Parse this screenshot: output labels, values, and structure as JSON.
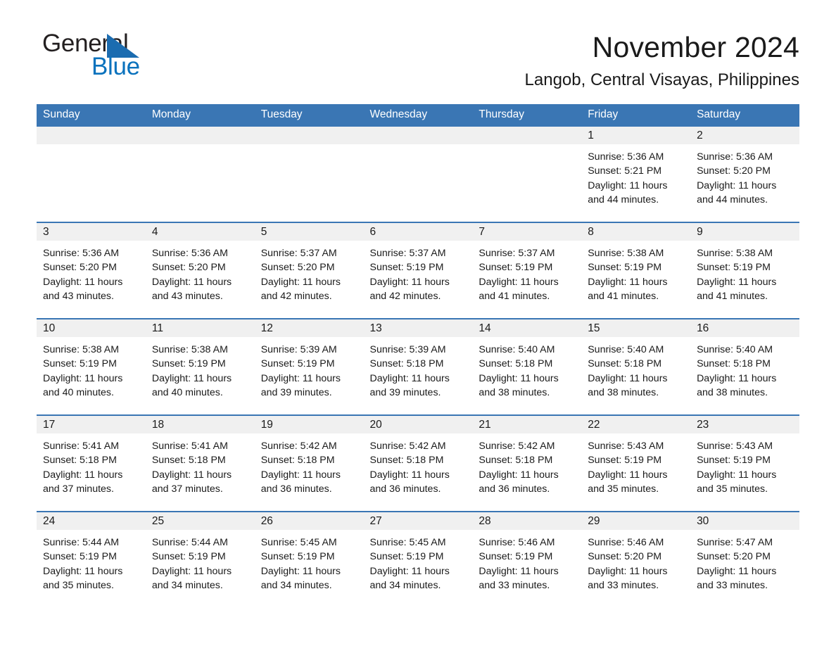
{
  "brand": {
    "name_part1": "General",
    "name_part2": "Blue",
    "logo_icon": "triangle-logo-icon",
    "accent_color": "#1b6cb0"
  },
  "header": {
    "title": "November 2024",
    "subtitle": "Langob, Central Visayas, Philippines"
  },
  "calendar": {
    "header_bg": "#3a76b4",
    "daynum_bg": "#f0f0f0",
    "weekdays": [
      "Sunday",
      "Monday",
      "Tuesday",
      "Wednesday",
      "Thursday",
      "Friday",
      "Saturday"
    ],
    "weeks": [
      [
        {
          "day": "",
          "lines": []
        },
        {
          "day": "",
          "lines": []
        },
        {
          "day": "",
          "lines": []
        },
        {
          "day": "",
          "lines": []
        },
        {
          "day": "",
          "lines": []
        },
        {
          "day": "1",
          "lines": [
            "Sunrise: 5:36 AM",
            "Sunset: 5:21 PM",
            "Daylight: 11 hours and 44 minutes."
          ]
        },
        {
          "day": "2",
          "lines": [
            "Sunrise: 5:36 AM",
            "Sunset: 5:20 PM",
            "Daylight: 11 hours and 44 minutes."
          ]
        }
      ],
      [
        {
          "day": "3",
          "lines": [
            "Sunrise: 5:36 AM",
            "Sunset: 5:20 PM",
            "Daylight: 11 hours and 43 minutes."
          ]
        },
        {
          "day": "4",
          "lines": [
            "Sunrise: 5:36 AM",
            "Sunset: 5:20 PM",
            "Daylight: 11 hours and 43 minutes."
          ]
        },
        {
          "day": "5",
          "lines": [
            "Sunrise: 5:37 AM",
            "Sunset: 5:20 PM",
            "Daylight: 11 hours and 42 minutes."
          ]
        },
        {
          "day": "6",
          "lines": [
            "Sunrise: 5:37 AM",
            "Sunset: 5:19 PM",
            "Daylight: 11 hours and 42 minutes."
          ]
        },
        {
          "day": "7",
          "lines": [
            "Sunrise: 5:37 AM",
            "Sunset: 5:19 PM",
            "Daylight: 11 hours and 41 minutes."
          ]
        },
        {
          "day": "8",
          "lines": [
            "Sunrise: 5:38 AM",
            "Sunset: 5:19 PM",
            "Daylight: 11 hours and 41 minutes."
          ]
        },
        {
          "day": "9",
          "lines": [
            "Sunrise: 5:38 AM",
            "Sunset: 5:19 PM",
            "Daylight: 11 hours and 41 minutes."
          ]
        }
      ],
      [
        {
          "day": "10",
          "lines": [
            "Sunrise: 5:38 AM",
            "Sunset: 5:19 PM",
            "Daylight: 11 hours and 40 minutes."
          ]
        },
        {
          "day": "11",
          "lines": [
            "Sunrise: 5:38 AM",
            "Sunset: 5:19 PM",
            "Daylight: 11 hours and 40 minutes."
          ]
        },
        {
          "day": "12",
          "lines": [
            "Sunrise: 5:39 AM",
            "Sunset: 5:19 PM",
            "Daylight: 11 hours and 39 minutes."
          ]
        },
        {
          "day": "13",
          "lines": [
            "Sunrise: 5:39 AM",
            "Sunset: 5:18 PM",
            "Daylight: 11 hours and 39 minutes."
          ]
        },
        {
          "day": "14",
          "lines": [
            "Sunrise: 5:40 AM",
            "Sunset: 5:18 PM",
            "Daylight: 11 hours and 38 minutes."
          ]
        },
        {
          "day": "15",
          "lines": [
            "Sunrise: 5:40 AM",
            "Sunset: 5:18 PM",
            "Daylight: 11 hours and 38 minutes."
          ]
        },
        {
          "day": "16",
          "lines": [
            "Sunrise: 5:40 AM",
            "Sunset: 5:18 PM",
            "Daylight: 11 hours and 38 minutes."
          ]
        }
      ],
      [
        {
          "day": "17",
          "lines": [
            "Sunrise: 5:41 AM",
            "Sunset: 5:18 PM",
            "Daylight: 11 hours and 37 minutes."
          ]
        },
        {
          "day": "18",
          "lines": [
            "Sunrise: 5:41 AM",
            "Sunset: 5:18 PM",
            "Daylight: 11 hours and 37 minutes."
          ]
        },
        {
          "day": "19",
          "lines": [
            "Sunrise: 5:42 AM",
            "Sunset: 5:18 PM",
            "Daylight: 11 hours and 36 minutes."
          ]
        },
        {
          "day": "20",
          "lines": [
            "Sunrise: 5:42 AM",
            "Sunset: 5:18 PM",
            "Daylight: 11 hours and 36 minutes."
          ]
        },
        {
          "day": "21",
          "lines": [
            "Sunrise: 5:42 AM",
            "Sunset: 5:18 PM",
            "Daylight: 11 hours and 36 minutes."
          ]
        },
        {
          "day": "22",
          "lines": [
            "Sunrise: 5:43 AM",
            "Sunset: 5:19 PM",
            "Daylight: 11 hours and 35 minutes."
          ]
        },
        {
          "day": "23",
          "lines": [
            "Sunrise: 5:43 AM",
            "Sunset: 5:19 PM",
            "Daylight: 11 hours and 35 minutes."
          ]
        }
      ],
      [
        {
          "day": "24",
          "lines": [
            "Sunrise: 5:44 AM",
            "Sunset: 5:19 PM",
            "Daylight: 11 hours and 35 minutes."
          ]
        },
        {
          "day": "25",
          "lines": [
            "Sunrise: 5:44 AM",
            "Sunset: 5:19 PM",
            "Daylight: 11 hours and 34 minutes."
          ]
        },
        {
          "day": "26",
          "lines": [
            "Sunrise: 5:45 AM",
            "Sunset: 5:19 PM",
            "Daylight: 11 hours and 34 minutes."
          ]
        },
        {
          "day": "27",
          "lines": [
            "Sunrise: 5:45 AM",
            "Sunset: 5:19 PM",
            "Daylight: 11 hours and 34 minutes."
          ]
        },
        {
          "day": "28",
          "lines": [
            "Sunrise: 5:46 AM",
            "Sunset: 5:19 PM",
            "Daylight: 11 hours and 33 minutes."
          ]
        },
        {
          "day": "29",
          "lines": [
            "Sunrise: 5:46 AM",
            "Sunset: 5:20 PM",
            "Daylight: 11 hours and 33 minutes."
          ]
        },
        {
          "day": "30",
          "lines": [
            "Sunrise: 5:47 AM",
            "Sunset: 5:20 PM",
            "Daylight: 11 hours and 33 minutes."
          ]
        }
      ]
    ]
  }
}
